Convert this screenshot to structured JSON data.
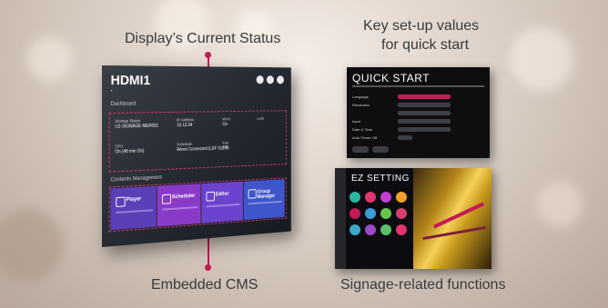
{
  "captions": {
    "status": "Display’s Current Status",
    "keysetup_line1": "Key set-up values",
    "keysetup_line2": "for quick start",
    "cms": "Embedded CMS",
    "signage": "Signage-related functions"
  },
  "accent_color": "#c41a55",
  "tv": {
    "input": "HDMI1",
    "dashboard_label": "Dashboard",
    "content_management_label": "Contents Management",
    "cells": [
      {
        "label": "Storage Status",
        "value": "LG SIGNAGE MER001"
      },
      {
        "label": "IP Address",
        "value": "10.12.34"
      },
      {
        "label": "Wi-Fi",
        "value": "On"
      },
      {
        "label": "Lock",
        "value": ""
      },
      {
        "label": "CPU",
        "value": "On (48 min On)"
      },
      {
        "label": "Schedule",
        "value": "Wired Connected (LEF 512 F)"
      },
      {
        "label": "Fan",
        "value": "Off"
      },
      {
        "label": "",
        "value": ""
      }
    ],
    "tiles": [
      {
        "label": "Player",
        "color": "#5b3fb7"
      },
      {
        "label": "Scheduler",
        "color": "#8a3ac9"
      },
      {
        "label": "Editor",
        "color": "#6c43cf"
      },
      {
        "label": "Group Manager",
        "color": "#3e56c9"
      }
    ],
    "header_icons": [
      "settings-icon",
      "info-icon",
      "power-icon"
    ]
  },
  "quick_start": {
    "title": "QUICK START",
    "rows": [
      "Language",
      "Resolution",
      "",
      "Input",
      "Date & Time",
      "Auto Power Off"
    ]
  },
  "ez_setting": {
    "title": "EZ SETTING",
    "icon_colors": [
      "#2db7a0",
      "#e0356e",
      "#c13fd0",
      "#f0a12c",
      "#c41a55",
      "#3e9ad6",
      "#6ac44a",
      "#d43f6b",
      "#3ba8c9",
      "#9a49c9",
      "#5bbf6a",
      "#e0356e"
    ]
  }
}
